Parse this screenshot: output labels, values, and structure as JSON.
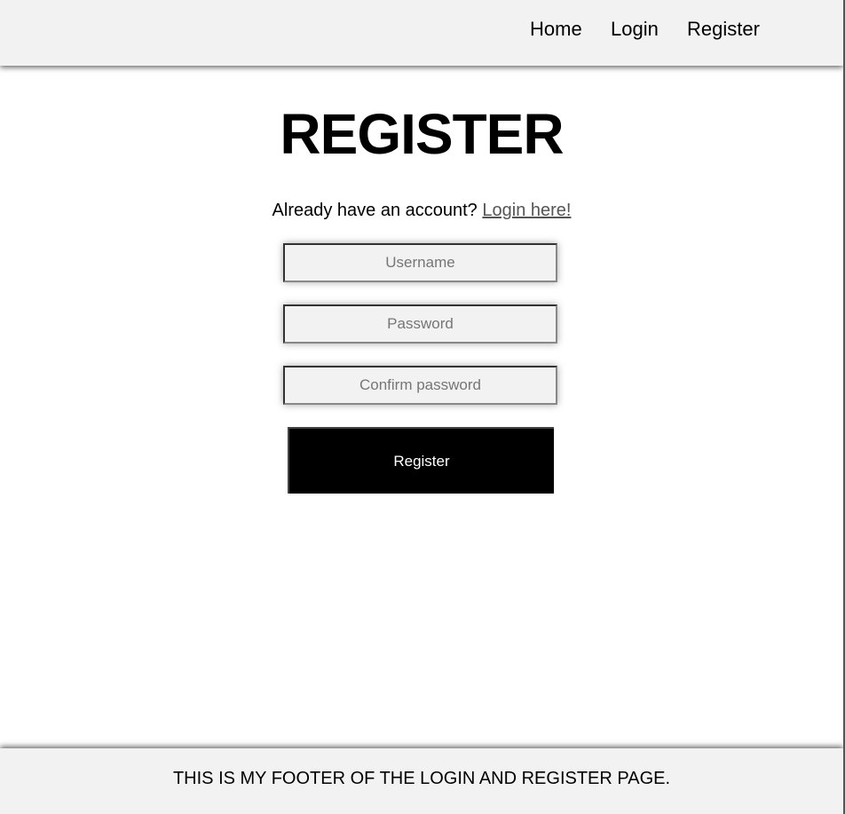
{
  "nav": {
    "home": "Home",
    "login": "Login",
    "register": "Register"
  },
  "main": {
    "title": "REGISTER",
    "account_prompt": "Already have an account?",
    "login_link": "Login here!",
    "username_placeholder": "Username",
    "password_placeholder": "Password",
    "confirm_placeholder": "Confirm password",
    "submit_label": "Register"
  },
  "footer": {
    "text": "THIS IS MY FOOTER OF THE LOGIN AND REGISTER PAGE."
  },
  "colors": {
    "bar_background": "#f2f2f2",
    "button_background": "#000000",
    "link": "#555555"
  }
}
